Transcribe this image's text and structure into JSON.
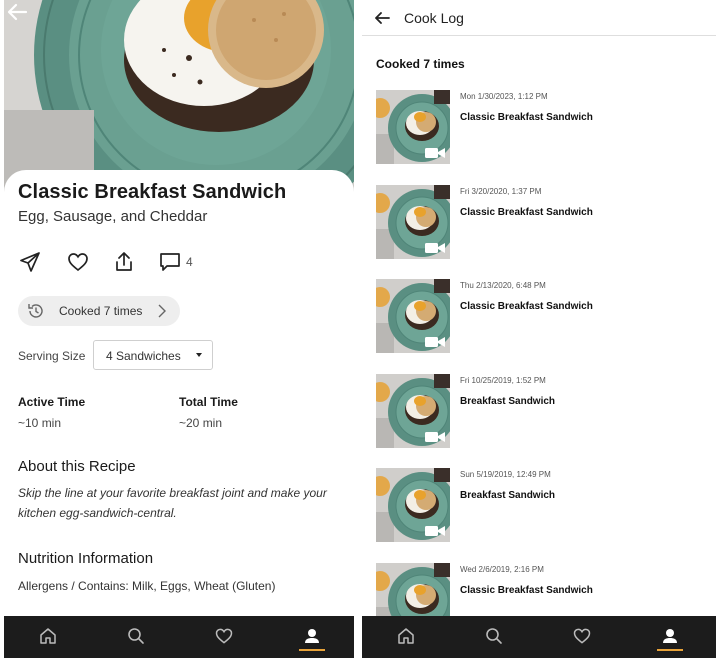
{
  "recipe": {
    "title": "Classic Breakfast Sandwich",
    "subtitle": "Egg, Sausage, and Cheddar",
    "comment_count": "4",
    "cooked_label": "Cooked 7 times",
    "serving_size_label": "Serving Size",
    "serving_size_value": "4 Sandwiches",
    "active_time_label": "Active Time",
    "active_time_value": "~10 min",
    "total_time_label": "Total Time",
    "total_time_value": "~20 min",
    "about_heading": "About this Recipe",
    "about_text": "Skip the line at your favorite breakfast joint and make your kitchen egg-sandwich-central.",
    "nutrition_heading": "Nutrition Information",
    "allergens_text": "Allergens / Contains: Milk, Eggs, Wheat (Gluten)"
  },
  "cook_log": {
    "title": "Cook Log",
    "count_label": "Cooked 7 times",
    "entries": [
      {
        "date": "Mon 1/30/2023, 1:12 PM",
        "name": "Classic Breakfast Sandwich"
      },
      {
        "date": "Fri 3/20/2020, 1:37 PM",
        "name": "Classic Breakfast Sandwich"
      },
      {
        "date": "Thu 2/13/2020, 6:48 PM",
        "name": "Classic Breakfast Sandwich"
      },
      {
        "date": "Fri 10/25/2019, 1:52 PM",
        "name": "Breakfast Sandwich"
      },
      {
        "date": "Sun 5/19/2019, 12:49 PM",
        "name": "Breakfast Sandwich"
      },
      {
        "date": "Wed 2/6/2019, 2:16 PM",
        "name": "Classic Breakfast Sandwich"
      }
    ]
  },
  "nav": {
    "items": [
      "home-icon",
      "search-icon",
      "heart-icon",
      "profile-icon"
    ],
    "active": "profile-icon"
  },
  "colors": {
    "accent": "#e8a33a",
    "nav_background": "#1c1c1c",
    "plate": "#5f9487"
  }
}
